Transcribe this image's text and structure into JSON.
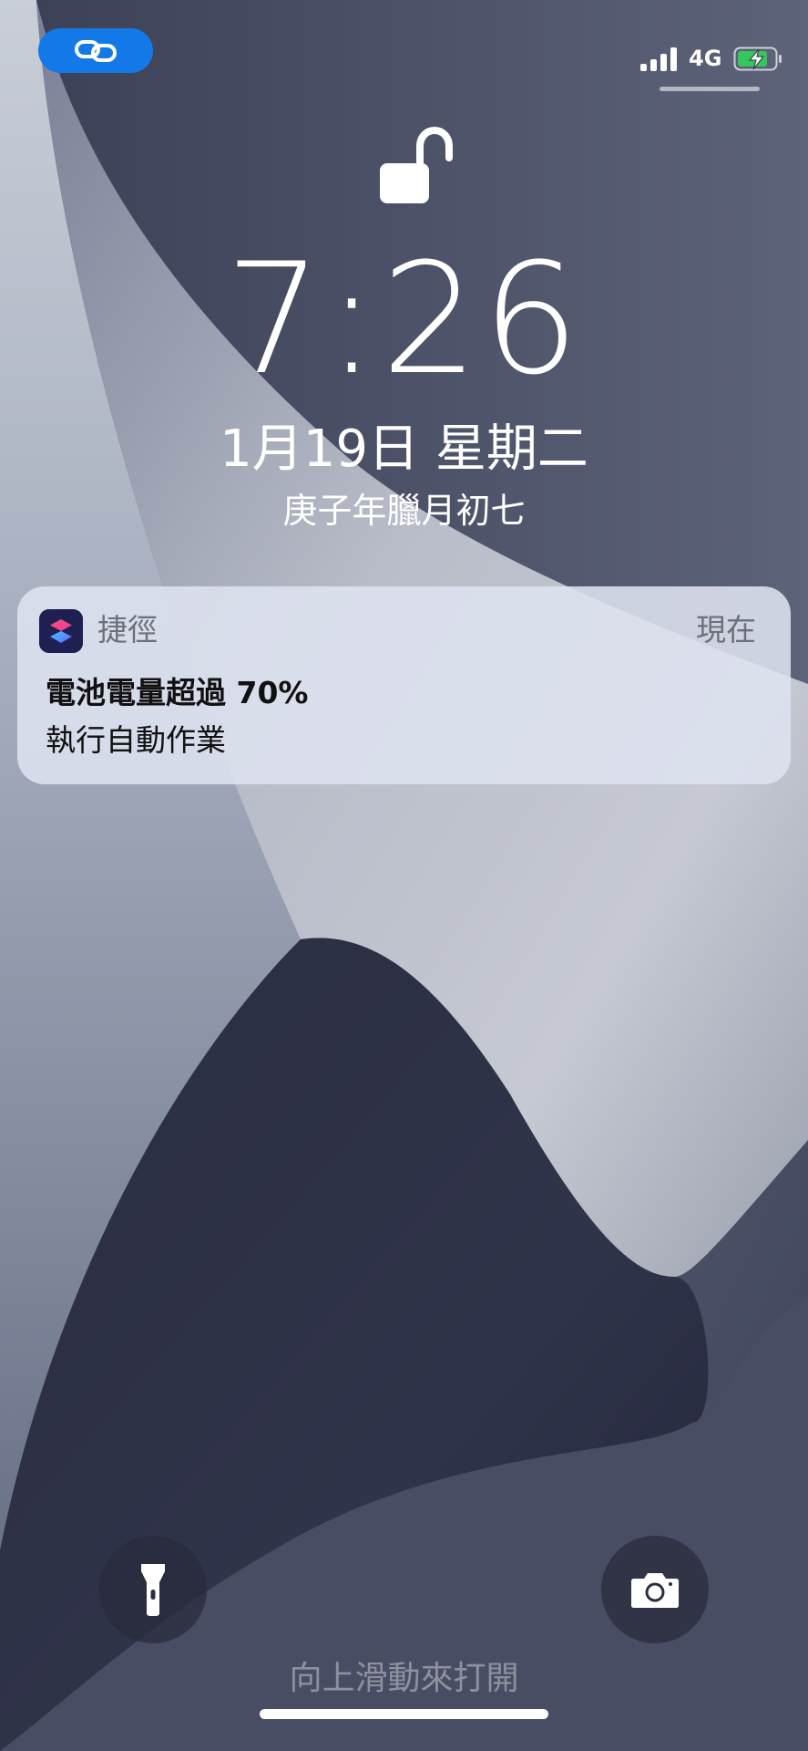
{
  "status_bar": {
    "network": "4G",
    "shortcut_pill_icon": "link-icon",
    "signal_bars": 4,
    "battery_state": "charging",
    "battery_color": "#34c759",
    "pill_color": "#1479e8"
  },
  "lockscreen": {
    "lock_icon": "unlocked-padlock-icon",
    "time": "7:26",
    "date": "1月19日 星期二",
    "lunar_date": "庚子年臘月初七"
  },
  "notification": {
    "app_icon": "shortcuts-app-icon",
    "app_name": "捷徑",
    "time": "現在",
    "title": "電池電量超過 70%",
    "body": "執行自動作業"
  },
  "bottom": {
    "flashlight_icon": "flashlight-icon",
    "camera_icon": "camera-icon",
    "swipe_hint": "向上滑動來打開"
  }
}
